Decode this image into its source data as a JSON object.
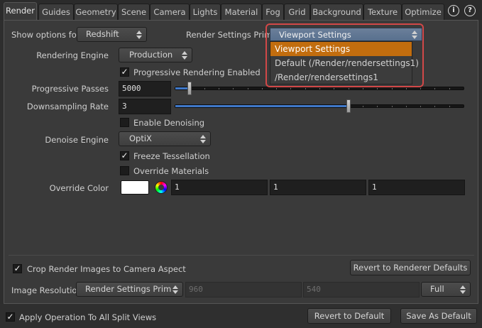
{
  "tabs": [
    "Render",
    "Guides",
    "Geometry",
    "Scene",
    "Camera",
    "Lights",
    "Material",
    "Fog",
    "Grid",
    "Background",
    "Texture",
    "Optimize"
  ],
  "tab_icons": [
    {
      "name": "info-icon",
      "glyph": "i"
    },
    {
      "name": "help-icon",
      "glyph": "?"
    }
  ],
  "show_options": {
    "label": "Show options for",
    "value": "Redshift"
  },
  "render_settings_prim": {
    "label": "Render Settings Prim",
    "value": "Viewport Settings",
    "options": [
      "Viewport Settings",
      "Default (/Render/rendersettings1)",
      "/Render/rendersettings1"
    ],
    "selected_index": 0
  },
  "rendering_engine": {
    "label": "Rendering Engine",
    "value": "Production"
  },
  "progressive_rendering": {
    "label": "Progressive Rendering Enabled",
    "checked": true
  },
  "progressive_passes": {
    "label": "Progressive Passes",
    "value": "5000",
    "fraction": 0.05
  },
  "downsampling_rate": {
    "label": "Downsampling Rate",
    "value": "3",
    "fraction": 0.6
  },
  "enable_denoising": {
    "label": "Enable Denoising",
    "checked": false
  },
  "denoise_engine": {
    "label": "Denoise Engine",
    "value": "OptiX"
  },
  "freeze_tessellation": {
    "label": "Freeze Tessellation",
    "checked": true
  },
  "override_materials": {
    "label": "Override Materials",
    "checked": false
  },
  "override_color": {
    "label": "Override Color",
    "color": "#ffffff",
    "r": "1",
    "g": "1",
    "b": "1"
  },
  "crop_render": {
    "label": "Crop Render Images to Camera Aspect",
    "checked": true
  },
  "revert_renderer_defaults": "Revert to Renderer Defaults",
  "image_resolution": {
    "label": "Image Resolution",
    "mode": "Render Settings Prim",
    "width": "960",
    "height": "540",
    "scale": "Full"
  },
  "apply_all_split": {
    "label": "Apply Operation To All Split Views",
    "checked": true
  },
  "revert_default": "Revert to Default",
  "save_default": "Save As Default",
  "colors": {
    "accent_selection": "#c26d0e",
    "slider_fill": "#3f78c8",
    "highlight_box": "#d14848"
  }
}
